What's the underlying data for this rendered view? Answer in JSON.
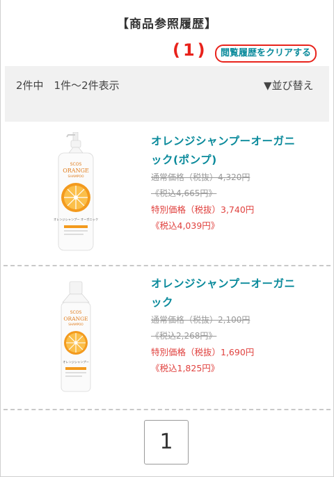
{
  "page_title": "【商品参照履歴】",
  "annotation_marker": "(1)",
  "clear_history_link": "閲覧履歴をクリアする",
  "results": {
    "count_text": "2件中　1件～2件表示",
    "sort_label": "▼並び替え"
  },
  "products": [
    {
      "name": "オレンジシャンプーオーガニック(ポンプ)",
      "regular_price": "通常価格（税抜）4,320円",
      "regular_tax_incl": "《税込4,665円》",
      "special_price": "特別価格（税抜）3,740円",
      "special_tax_incl": "《税込4,039円》",
      "image": {
        "brand": "SCOS",
        "line": "ORANGE",
        "type": "SHAMPOO",
        "label_jp": "オレンジシャンプー オーガニック"
      }
    },
    {
      "name": "オレンジシャンプーオーガニック",
      "regular_price": "通常価格（税抜）2,100円",
      "regular_tax_incl": "《税込2,268円》",
      "special_price": "特別価格（税抜）1,690円",
      "special_tax_incl": "《税込1,825円》",
      "image": {
        "brand": "SCOS",
        "line": "ORANGE",
        "type": "SHAMPOO",
        "label_jp": "オレンジシャンプー"
      }
    }
  ],
  "pagination": {
    "current_page": "1"
  },
  "colors": {
    "accent_teal": "#0a8a9b",
    "sale_red": "#e0413e",
    "annotation_red": "#e8221b",
    "orange": "#f39a1e"
  }
}
